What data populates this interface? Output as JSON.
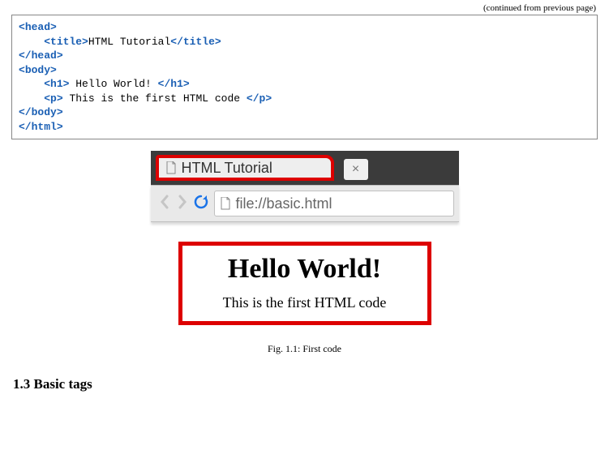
{
  "continued_label": "(continued from previous page)",
  "code": {
    "l1a": "<",
    "l1b": "head",
    "l1c": ">",
    "l2a": "    <",
    "l2b": "title",
    "l2c": ">",
    "l2txt": "HTML Tutorial",
    "l2d": "</",
    "l2e": "title",
    "l2f": ">",
    "l3a": "</",
    "l3b": "head",
    "l3c": ">",
    "l4a": "<",
    "l4b": "body",
    "l4c": ">",
    "l5a": "    <",
    "l5b": "h1",
    "l5c": ">",
    "l5txt": " Hello World! ",
    "l5d": "</",
    "l5e": "h1",
    "l5f": ">",
    "l6a": "    <",
    "l6b": "p",
    "l6c": ">",
    "l6txt": " This is the first HTML code ",
    "l6d": "</",
    "l6e": "p",
    "l6f": ">",
    "l7a": "</",
    "l7b": "body",
    "l7c": ">",
    "l8a": "</",
    "l8b": "html",
    "l8c": ">"
  },
  "browser": {
    "tab_title": "HTML Tutorial",
    "close_glyph": "×",
    "url": "file://basic.html"
  },
  "rendered": {
    "h1": "Hello World!",
    "p": "This is the first HTML code"
  },
  "caption": "Fig. 1.1: First code",
  "section": "1.3  Basic tags"
}
